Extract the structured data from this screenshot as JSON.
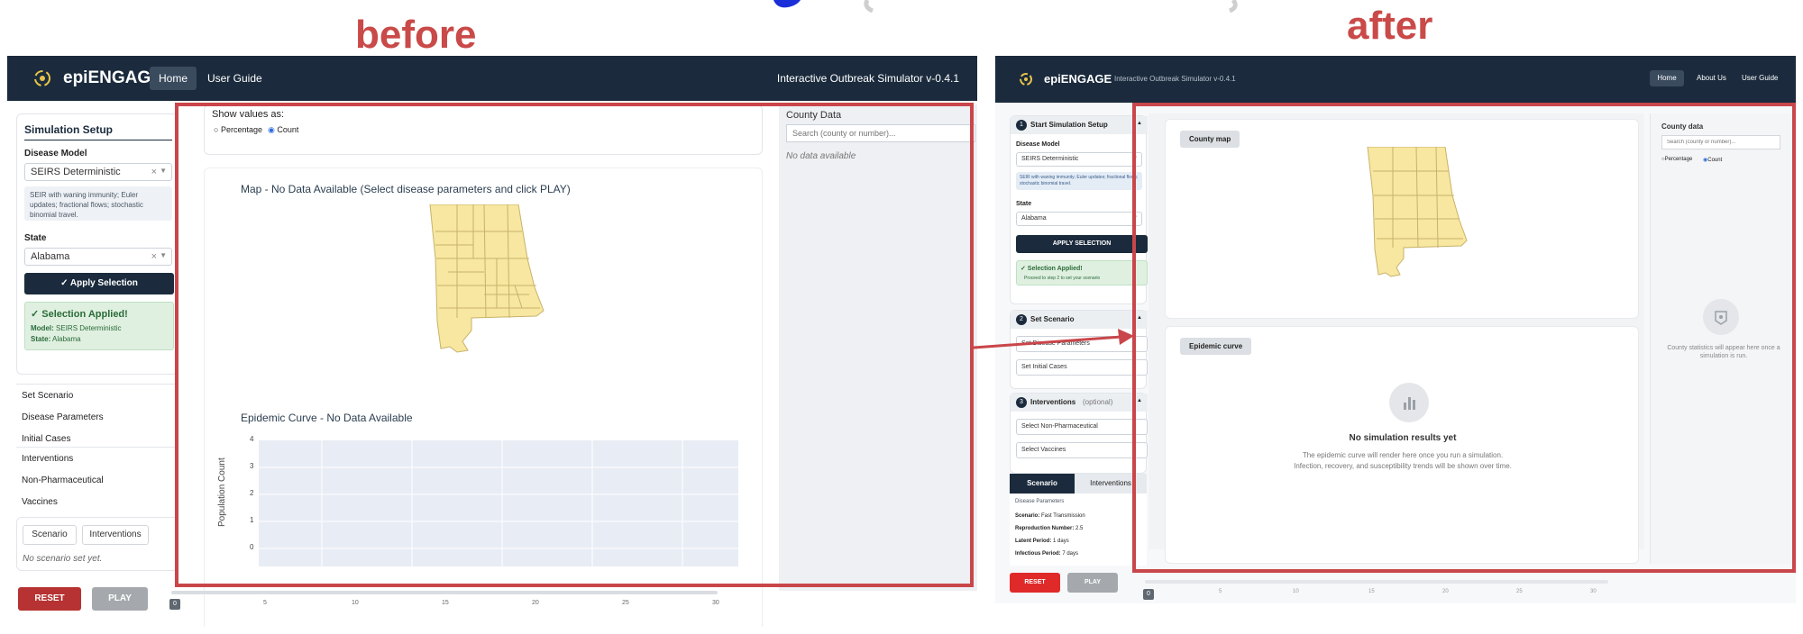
{
  "captions": {
    "before": "before",
    "after": "after"
  },
  "before": {
    "brand": "epiENGAGE",
    "nav": {
      "home": "Home",
      "user_guide": "User Guide",
      "version": "Interactive Outbreak Simulator v-0.4.1"
    },
    "sidebar": {
      "title": "Simulation Setup",
      "disease_model_label": "Disease Model",
      "disease_model_value": "SEIRS Deterministic",
      "model_note": "SEIR with waning immunity; Euler updates; fractional flows; stochastic binomial travel.",
      "state_label": "State",
      "state_value": "Alabama",
      "apply_button": "✓ Apply Selection",
      "applied_title": "✓ Selection Applied!",
      "applied_model_key": "Model:",
      "applied_model_val": "SEIRS Deterministic",
      "applied_state_key": "State:",
      "applied_state_val": "Alabama",
      "set_scenario": "Set Scenario",
      "disease_parameters": "Disease Parameters",
      "initial_cases": "Initial Cases",
      "interventions": "Interventions",
      "non_pharmaceutical": "Non-Pharmaceutical",
      "vaccines": "Vaccines",
      "tab_scenario": "Scenario",
      "tab_interventions": "Interventions",
      "no_scenario": "No scenario set yet.",
      "reset": "RESET",
      "play": "PLAY"
    },
    "main": {
      "show_values_as": "Show values as:",
      "opt_percentage": "Percentage",
      "opt_count": "Count",
      "map_title": "Map - No Data Available (Select disease parameters and click PLAY)",
      "curve_title": "Epidemic Curve - No Data Available",
      "y_axis_label": "Population Count",
      "y_ticks": [
        "4",
        "3",
        "2",
        "1",
        "0"
      ],
      "slider_ticks": [
        "0",
        "5",
        "10",
        "15",
        "20",
        "25",
        "30"
      ]
    },
    "county": {
      "title": "County Data",
      "search_placeholder": "Search (county or number)...",
      "empty": "No data available"
    }
  },
  "after": {
    "brand": "epiENGAGE",
    "subtitle": "Interactive Outbreak Simulator v-0.4.1",
    "nav": {
      "home": "Home",
      "about": "About Us",
      "user_guide": "User Guide"
    },
    "sidebar": {
      "step1_title": "Start Simulation Setup",
      "disease_model_label": "Disease Model",
      "disease_model_value": "SEIRS Deterministic",
      "model_note": "SEIR with waning immunity; Euler updates; fractional flows; stochastic binomial travel.",
      "state_label": "State",
      "state_value": "Alabama",
      "apply_button": "APPLY SELECTION",
      "applied_title": "✓ Selection Applied!",
      "applied_sub": "Proceed to step 2 to set your scenario",
      "step2_title": "Set Scenario",
      "set_disease_parameters": "Set Disease Parameters",
      "set_initial_cases": "Set Initial Cases",
      "step3_title": "Interventions",
      "step3_optional": "(optional)",
      "select_non_pharma": "Select Non-Pharmaceutical",
      "select_vaccines": "Select Vaccines",
      "tab_scenario": "Scenario",
      "tab_interventions": "Interventions",
      "dp_heading": "Disease Parameters",
      "scenario_key": "Scenario:",
      "scenario_val": "Fast Transmission",
      "r_key": "Reproduction Number:",
      "r_val": "2.5",
      "latent_key": "Latent Period:",
      "latent_val": "1 days",
      "infectious_key": "Infectious Period:",
      "infectious_val": "7 days",
      "reset": "RESET",
      "play": "PLAY"
    },
    "main": {
      "county_map_badge": "County map",
      "epi_curve_badge": "Epidemic curve",
      "no_results_title": "No simulation results yet",
      "no_results_line1": "The epidemic curve will render here once you run a simulation.",
      "no_results_line2": "Infection, recovery, and susceptibility trends will be shown over time.",
      "slider_ticks": [
        "0",
        "5",
        "10",
        "15",
        "20",
        "25",
        "30"
      ]
    },
    "county": {
      "title": "County data",
      "search_placeholder": "Search (county or number)...",
      "opt_percentage": "Percentage",
      "opt_count": "Count",
      "empty_text": "County statistics will appear here once a simulation is run."
    }
  },
  "colors": {
    "nav": "#1b2b3d",
    "frame": "#c9464a",
    "caption": "#c94a48",
    "map_fill": "#f7e7a0",
    "chart_bg": "#e8ecf5"
  }
}
